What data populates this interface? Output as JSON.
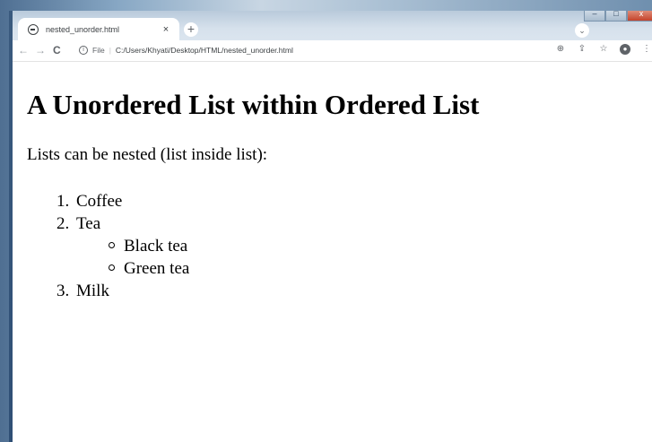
{
  "browser": {
    "tab_title": "nested_unorder.html",
    "tab_close": "×",
    "new_tab": "+",
    "omnibox": {
      "scheme_label": "File",
      "url": "C:/Users/Khyati/Desktop/HTML/nested_unorder.html"
    },
    "icons": [
      "back-icon",
      "forward-icon",
      "reload-icon",
      "info-icon",
      "zoom-icon",
      "share-icon",
      "star-icon",
      "profile-icon",
      "menu-icon"
    ]
  },
  "page": {
    "heading": "A Unordered List within Ordered List",
    "intro": "Lists can be nested (list inside list):",
    "ordered_list": [
      {
        "number": "1.",
        "text": "Coffee"
      },
      {
        "number": "2.",
        "text": "Tea",
        "sub_items": [
          "Black tea",
          "Green tea"
        ]
      },
      {
        "number": "3.",
        "text": "Milk"
      }
    ]
  }
}
